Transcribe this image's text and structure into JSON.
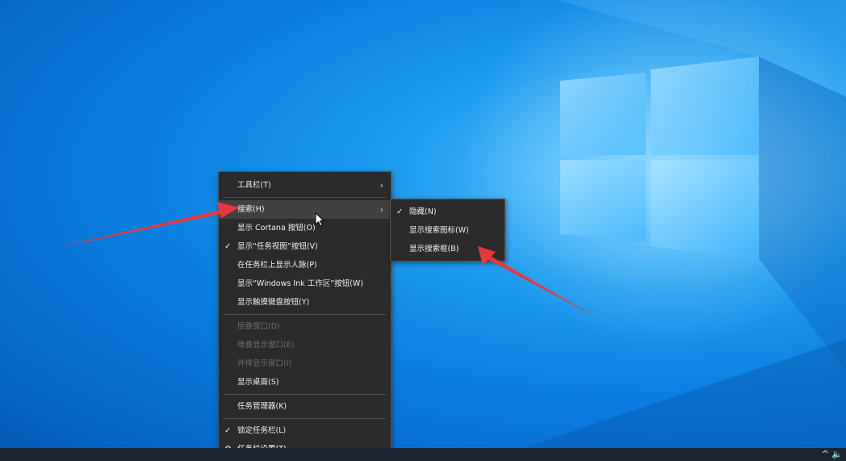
{
  "context_menu": {
    "items": [
      {
        "label": "工具栏(T)",
        "checked": false,
        "disabled": false,
        "submenu": true
      },
      {
        "label": "搜索(H)",
        "checked": false,
        "disabled": false,
        "submenu": true,
        "highlighted": true
      },
      {
        "label": "显示 Cortana 按钮(O)",
        "checked": false,
        "disabled": false
      },
      {
        "label": "显示“任务视图”按钮(V)",
        "checked": true,
        "disabled": false
      },
      {
        "label": "在任务栏上显示人脉(P)",
        "checked": false,
        "disabled": false
      },
      {
        "label": "显示“Windows Ink 工作区”按钮(W)",
        "checked": false,
        "disabled": false
      },
      {
        "label": "显示触摸键盘按钮(Y)",
        "checked": false,
        "disabled": false
      },
      {
        "label": "层叠窗口(D)",
        "checked": false,
        "disabled": true
      },
      {
        "label": "堆叠显示窗口(E)",
        "checked": false,
        "disabled": true
      },
      {
        "label": "并排显示窗口(I)",
        "checked": false,
        "disabled": true
      },
      {
        "label": "显示桌面(S)",
        "checked": false,
        "disabled": false
      },
      {
        "label": "任务管理器(K)",
        "checked": false,
        "disabled": false
      },
      {
        "label": "锁定任务栏(L)",
        "checked": true,
        "disabled": false
      },
      {
        "label": "任务栏设置(T)",
        "checked": false,
        "disabled": false,
        "icon": "gear-icon"
      }
    ]
  },
  "submenu": {
    "items": [
      {
        "label": "隐藏(N)",
        "checked": true
      },
      {
        "label": "显示搜索图标(W)",
        "checked": false
      },
      {
        "label": "显示搜索框(B)",
        "checked": false
      }
    ]
  },
  "glyphs": {
    "check": "✓",
    "arrow": "›",
    "gear": "⚙"
  },
  "taskbar": {
    "tray_text": "^ 🔈"
  },
  "colors": {
    "menu_bg": "#2b2b2b",
    "highlight": "#414141",
    "annotation_arrow": "#e8383d",
    "desktop_blue": "#0a7fe0"
  }
}
